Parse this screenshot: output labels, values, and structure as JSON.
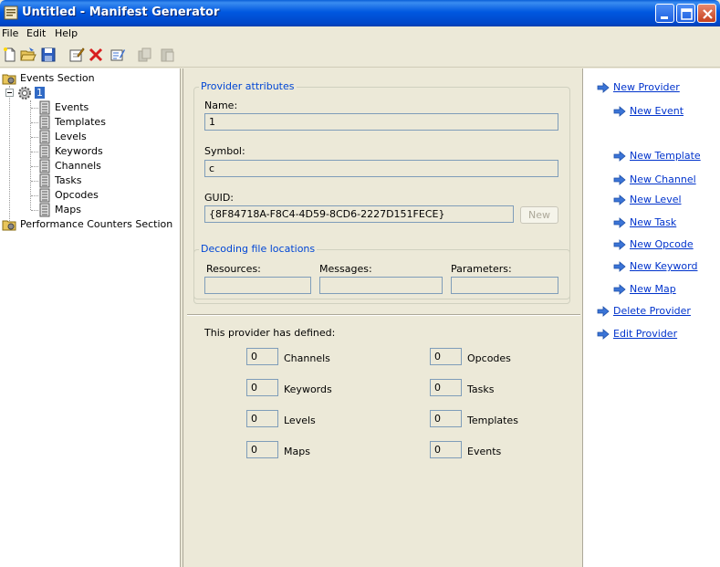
{
  "window": {
    "title": "Untitled - Manifest Generator",
    "controls": [
      "minimize-icon",
      "maximize-icon",
      "close-icon"
    ]
  },
  "menu": [
    "File",
    "Edit",
    "Help"
  ],
  "toolbar": [
    "new-file-icon",
    "open-icon",
    "save-icon",
    "edit-icon",
    "delete-icon",
    "properties-icon",
    "copy-icon",
    "paste-icon"
  ],
  "tree": {
    "events_section": "Events Section",
    "provider": "1",
    "children": [
      "Events",
      "Templates",
      "Levels",
      "Keywords",
      "Channels",
      "Tasks",
      "Opcodes",
      "Maps"
    ],
    "perf_section": "Performance Counters Section"
  },
  "provider_attributes": {
    "legend": "Provider attributes",
    "name_label": "Name:",
    "name_value": "1",
    "symbol_label": "Symbol:",
    "symbol_value": "c",
    "guid_label": "GUID:",
    "guid_value": "{8F84718A-F8C4-4D59-8CD6-2227D151FECE}",
    "new_button": "New"
  },
  "decoding": {
    "legend": "Decoding file locations",
    "resources_label": "Resources:",
    "messages_label": "Messages:",
    "parameters_label": "Parameters:",
    "resources_value": "",
    "messages_value": "",
    "parameters_value": ""
  },
  "summary": {
    "heading": "This provider has defined:",
    "left": [
      {
        "count": "0",
        "label": "Channels"
      },
      {
        "count": "0",
        "label": "Keywords"
      },
      {
        "count": "0",
        "label": "Levels"
      },
      {
        "count": "0",
        "label": "Maps"
      }
    ],
    "right": [
      {
        "count": "0",
        "label": "Opcodes"
      },
      {
        "count": "0",
        "label": "Tasks"
      },
      {
        "count": "0",
        "label": "Templates"
      },
      {
        "count": "0",
        "label": "Events"
      }
    ]
  },
  "actions": {
    "new_provider": "New Provider",
    "new_event": "New Event",
    "new_template": "New Template",
    "new_channel": "New Channel",
    "new_level": "New Level",
    "new_task": "New Task",
    "new_opcode": "New Opcode",
    "new_keyword": "New Keyword",
    "new_map": "New Map",
    "delete_provider": "Delete Provider",
    "edit_provider": "Edit Provider"
  },
  "colors": {
    "titlebar": "#0058e0",
    "window_bg": "#ece9d8",
    "legend_text": "#0046d5",
    "link": "#0033cc",
    "selection": "#316ac5"
  }
}
